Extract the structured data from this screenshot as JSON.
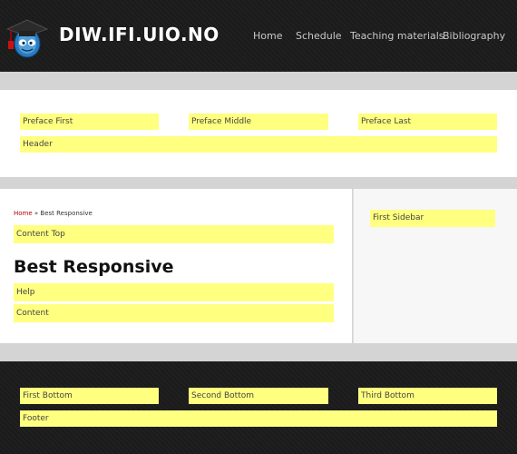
{
  "header": {
    "site_name": "DIW.IFI.UIO.NO",
    "nav": [
      "Home",
      "Schedule",
      "Teaching materials",
      "Bibliography"
    ]
  },
  "preface": {
    "first": "Preface First",
    "middle": "Preface Middle",
    "last": "Preface Last",
    "header": "Header"
  },
  "main": {
    "breadcrumb_home": "Home",
    "breadcrumb_sep": " » ",
    "breadcrumb_current": "Best Responsive",
    "content_top": "Content Top",
    "title": "Best Responsive",
    "help": "Help",
    "content": "Content"
  },
  "sidebar": {
    "first": "First Sidebar"
  },
  "bottom": {
    "first": "First Bottom",
    "second": "Second Bottom",
    "third": "Third Bottom",
    "footer": "Footer"
  },
  "colors": {
    "region_highlight": "#ffff80",
    "header_bg": "#1c1c1c",
    "breadcrumb_link": "#b00000"
  }
}
